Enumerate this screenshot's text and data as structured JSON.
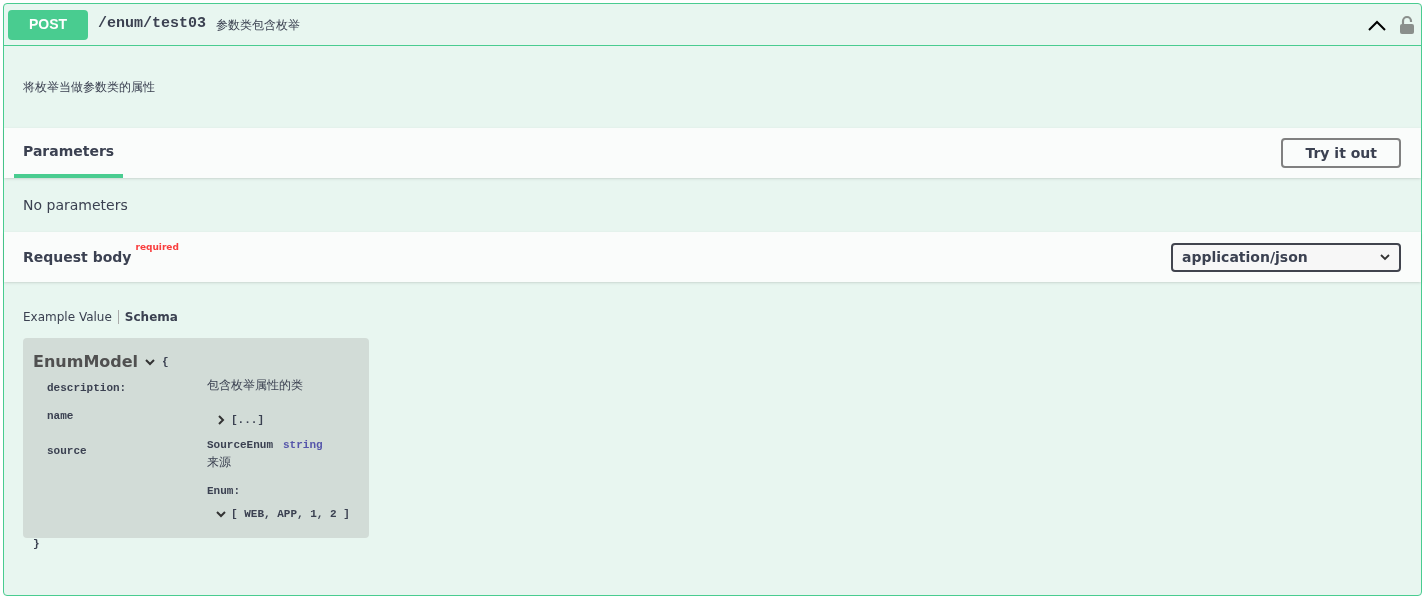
{
  "operation": {
    "method": "POST",
    "path": "/enum/test03",
    "summary": "参数类包含枚举",
    "expanded": true,
    "description": "将枚举当做参数类的属性"
  },
  "parameters": {
    "tab": "Parameters",
    "try_button": "Try it out",
    "empty_text": "No parameters"
  },
  "request_body": {
    "title": "Request body",
    "required_label": "required",
    "content_type": "application/json"
  },
  "schema_tabs": [
    {
      "label": "Example Value",
      "selected": false
    },
    {
      "label": "Schema",
      "selected": true
    }
  ],
  "model": {
    "name": "EnumModel",
    "expanded": true,
    "open_brace": "{",
    "close_brace": "}",
    "properties": [
      {
        "kind": "text",
        "name": "description:",
        "value": "包含枚举属性的类"
      },
      {
        "kind": "collapsed",
        "name": "name",
        "value": "[...]",
        "expanded": false
      },
      {
        "kind": "enum",
        "name": "source",
        "type_name": "SourceEnum",
        "type": "string",
        "description": "来源",
        "enum_label": "Enum:",
        "value": "[ WEB, APP, 1, 2 ]",
        "expanded": true
      }
    ]
  }
}
